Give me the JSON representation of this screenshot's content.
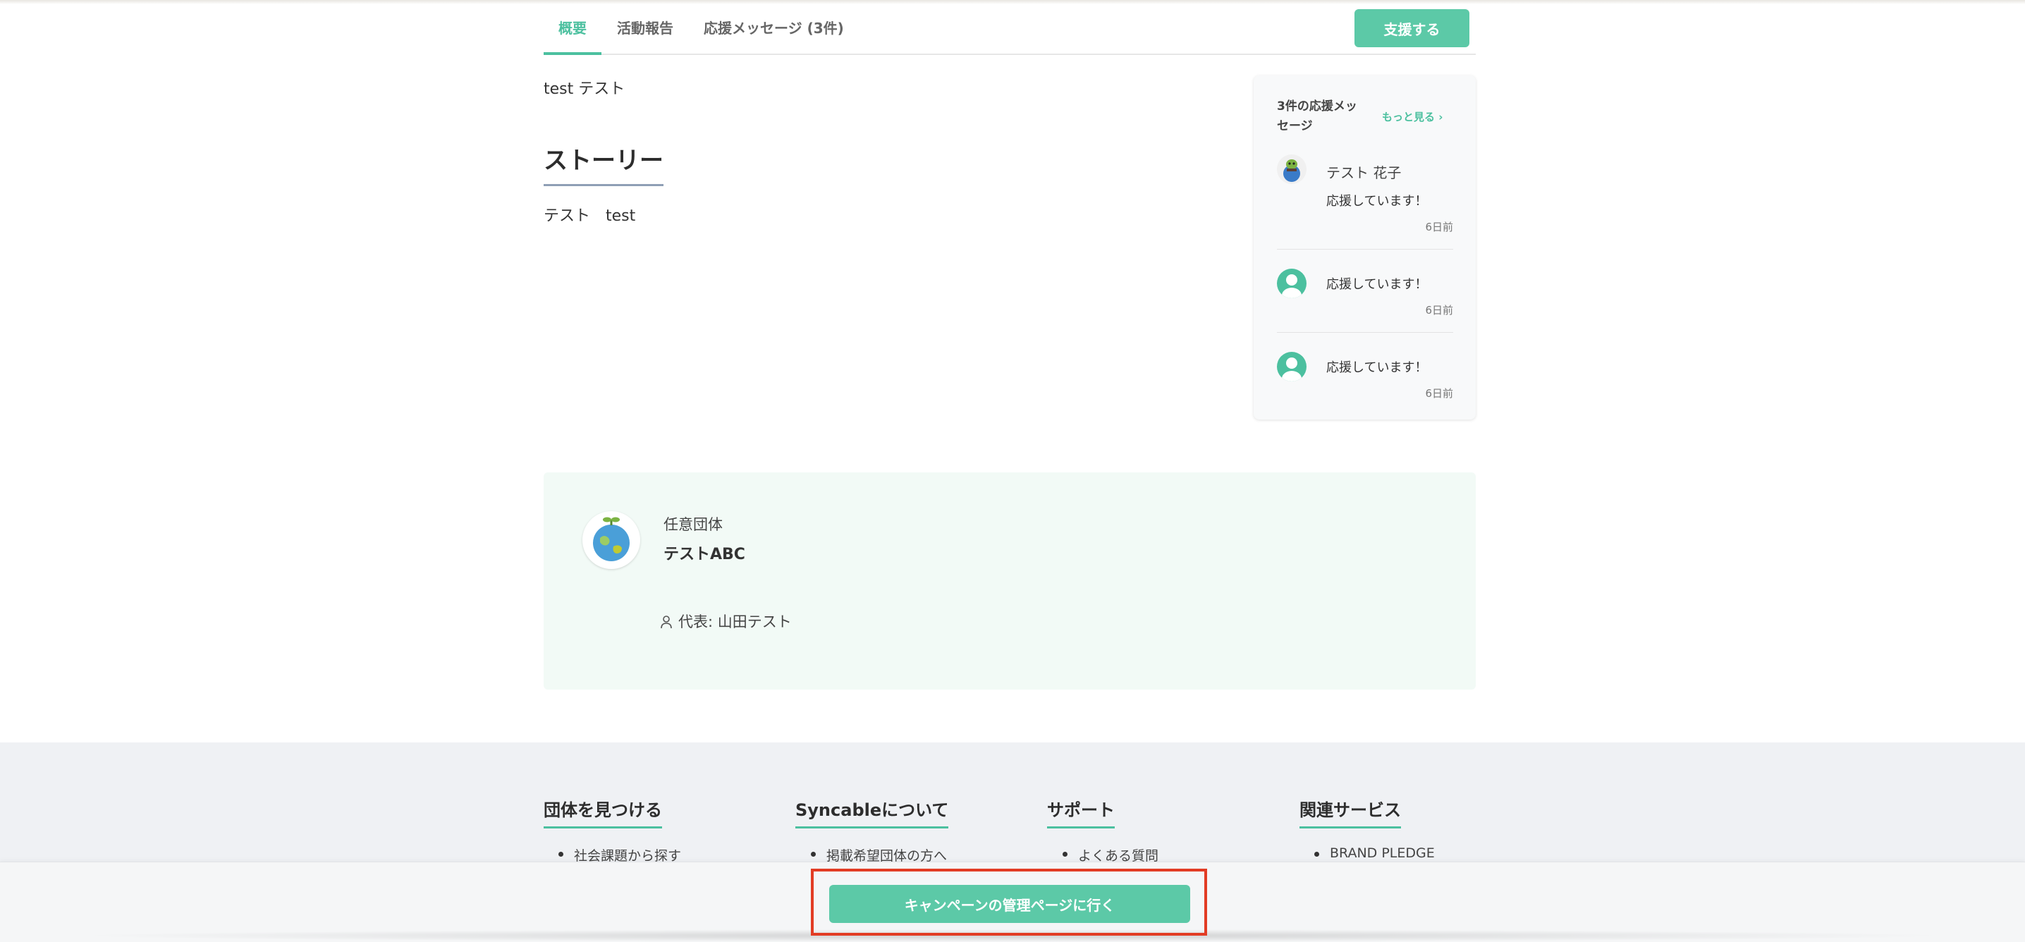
{
  "tabs": [
    {
      "label": "概要",
      "active": true
    },
    {
      "label": "活動報告",
      "active": false
    },
    {
      "label": "応援メッセージ (3件)",
      "active": false
    }
  ],
  "header": {
    "support_label": "支援する"
  },
  "main": {
    "lead_text": "test テスト",
    "story_title": "ストーリー",
    "story_body": "テスト　test"
  },
  "messages": {
    "title": "3件の応援メッセージ",
    "more_label": "もっと見る ›",
    "items": [
      {
        "name": "テスト 花子",
        "text": "応援しています！",
        "time": "6日前",
        "avatar": "illustrated-avatar"
      },
      {
        "name": "",
        "text": "応援しています！",
        "time": "6日前",
        "avatar": "default-user-avatar"
      },
      {
        "name": "",
        "text": "応援しています！",
        "time": "6日前",
        "avatar": "default-user-avatar"
      }
    ]
  },
  "organization": {
    "type": "任意団体",
    "name": "テストABC",
    "representative": "代表: 山田テスト",
    "logo": "earth-sprout-logo"
  },
  "footer": {
    "columns": [
      {
        "heading": "団体を見つける",
        "item": "社会課題から探す"
      },
      {
        "heading": "Syncableについて",
        "item": "掲載希望団体の方へ"
      },
      {
        "heading": "サポート",
        "item": "よくある質問"
      },
      {
        "heading": "関連サービス",
        "item": "BRAND PLEDGE"
      }
    ]
  },
  "bottom_bar": {
    "admin_label": "キャンペーンの管理ページに行く"
  },
  "colors": {
    "accent": "#4cc09f",
    "button": "#5cc9a7",
    "highlight": "#e23c24",
    "org_bg": "#f2faf6",
    "footer_bg": "#eff1f4"
  }
}
